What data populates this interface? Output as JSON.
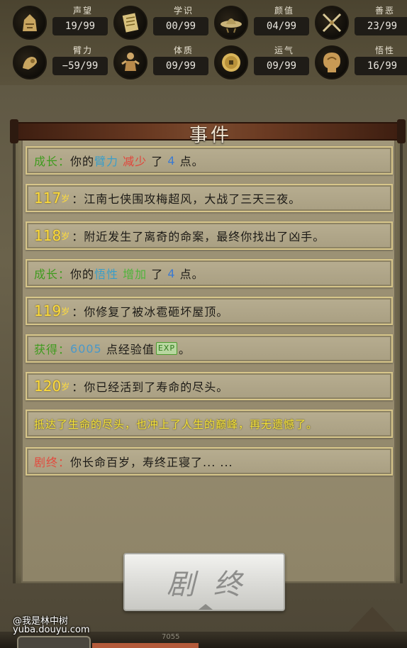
{
  "stats": [
    {
      "label": "声望",
      "value": "19/99",
      "icon": "reputation-icon"
    },
    {
      "label": "学识",
      "value": "00/99",
      "icon": "scroll-icon"
    },
    {
      "label": "颜值",
      "value": "04/99",
      "icon": "hat-icon"
    },
    {
      "label": "善恶",
      "value": "23/99",
      "icon": "crossed-swords-icon"
    },
    {
      "label": "臂力",
      "value": "−59/99",
      "icon": "arm-icon"
    },
    {
      "label": "体质",
      "value": "09/99",
      "icon": "body-icon"
    },
    {
      "label": "运气",
      "value": "09/99",
      "icon": "coin-icon"
    },
    {
      "label": "悟性",
      "value": "16/99",
      "icon": "head-icon"
    }
  ],
  "panel": {
    "title": "事件"
  },
  "events": [
    {
      "label": "成长：",
      "text1": "你的",
      "attr": "臂力",
      "change": "减少",
      "text2": "了",
      "num": "4",
      "text3": "点。"
    },
    {
      "age": "117",
      "unit": "岁",
      "colon": "：",
      "text": "江南七侠围攻梅超风，大战了三天三夜。"
    },
    {
      "age": "118",
      "unit": "岁",
      "colon": "：",
      "text": "附近发生了离奇的命案，最终你找出了凶手。"
    },
    {
      "label": "成长：",
      "text1": "你的",
      "attr": "悟性",
      "change": "增加",
      "text2": "了",
      "num": "4",
      "text3": "点。"
    },
    {
      "age": "119",
      "unit": "岁",
      "colon": "：",
      "text": "你修复了被冰雹砸坏屋顶。"
    },
    {
      "label": "获得：",
      "num": "6005",
      "text": "点经验值",
      "badge": "EXP",
      "end": "。"
    },
    {
      "age": "120",
      "unit": "岁",
      "colon": "：",
      "text": "你已经活到了寿命的尽头。"
    },
    {
      "text": "抵达了生命的尽头，也冲上了人生的巅峰，再无遗憾了。"
    },
    {
      "label": "剧终：",
      "text": "你长命百岁，寿终正寝了... ..."
    }
  ],
  "button": {
    "label": "剧终"
  },
  "watermark": {
    "line1": "@我是林中树",
    "line2": "yuba.douyu.com"
  },
  "bottom": {
    "number": "7055"
  },
  "colors": {
    "age": "#ffdc3c",
    "green": "#3f9b1e",
    "red": "#e2443a",
    "blue": "#3b7ad1",
    "yellow": "#f5e33a"
  }
}
